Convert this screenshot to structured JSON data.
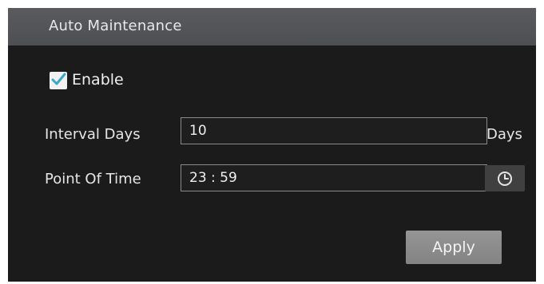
{
  "panel": {
    "title": "Auto Maintenance"
  },
  "enable": {
    "label": "Enable",
    "checked": true,
    "accent_color": "#3aa8c8"
  },
  "interval": {
    "label": "Interval Days",
    "value": "10",
    "unit": "Days"
  },
  "point_of_time": {
    "label": "Point Of Time",
    "value": "23 : 59",
    "icon": "clock-icon"
  },
  "actions": {
    "apply_label": "Apply"
  }
}
